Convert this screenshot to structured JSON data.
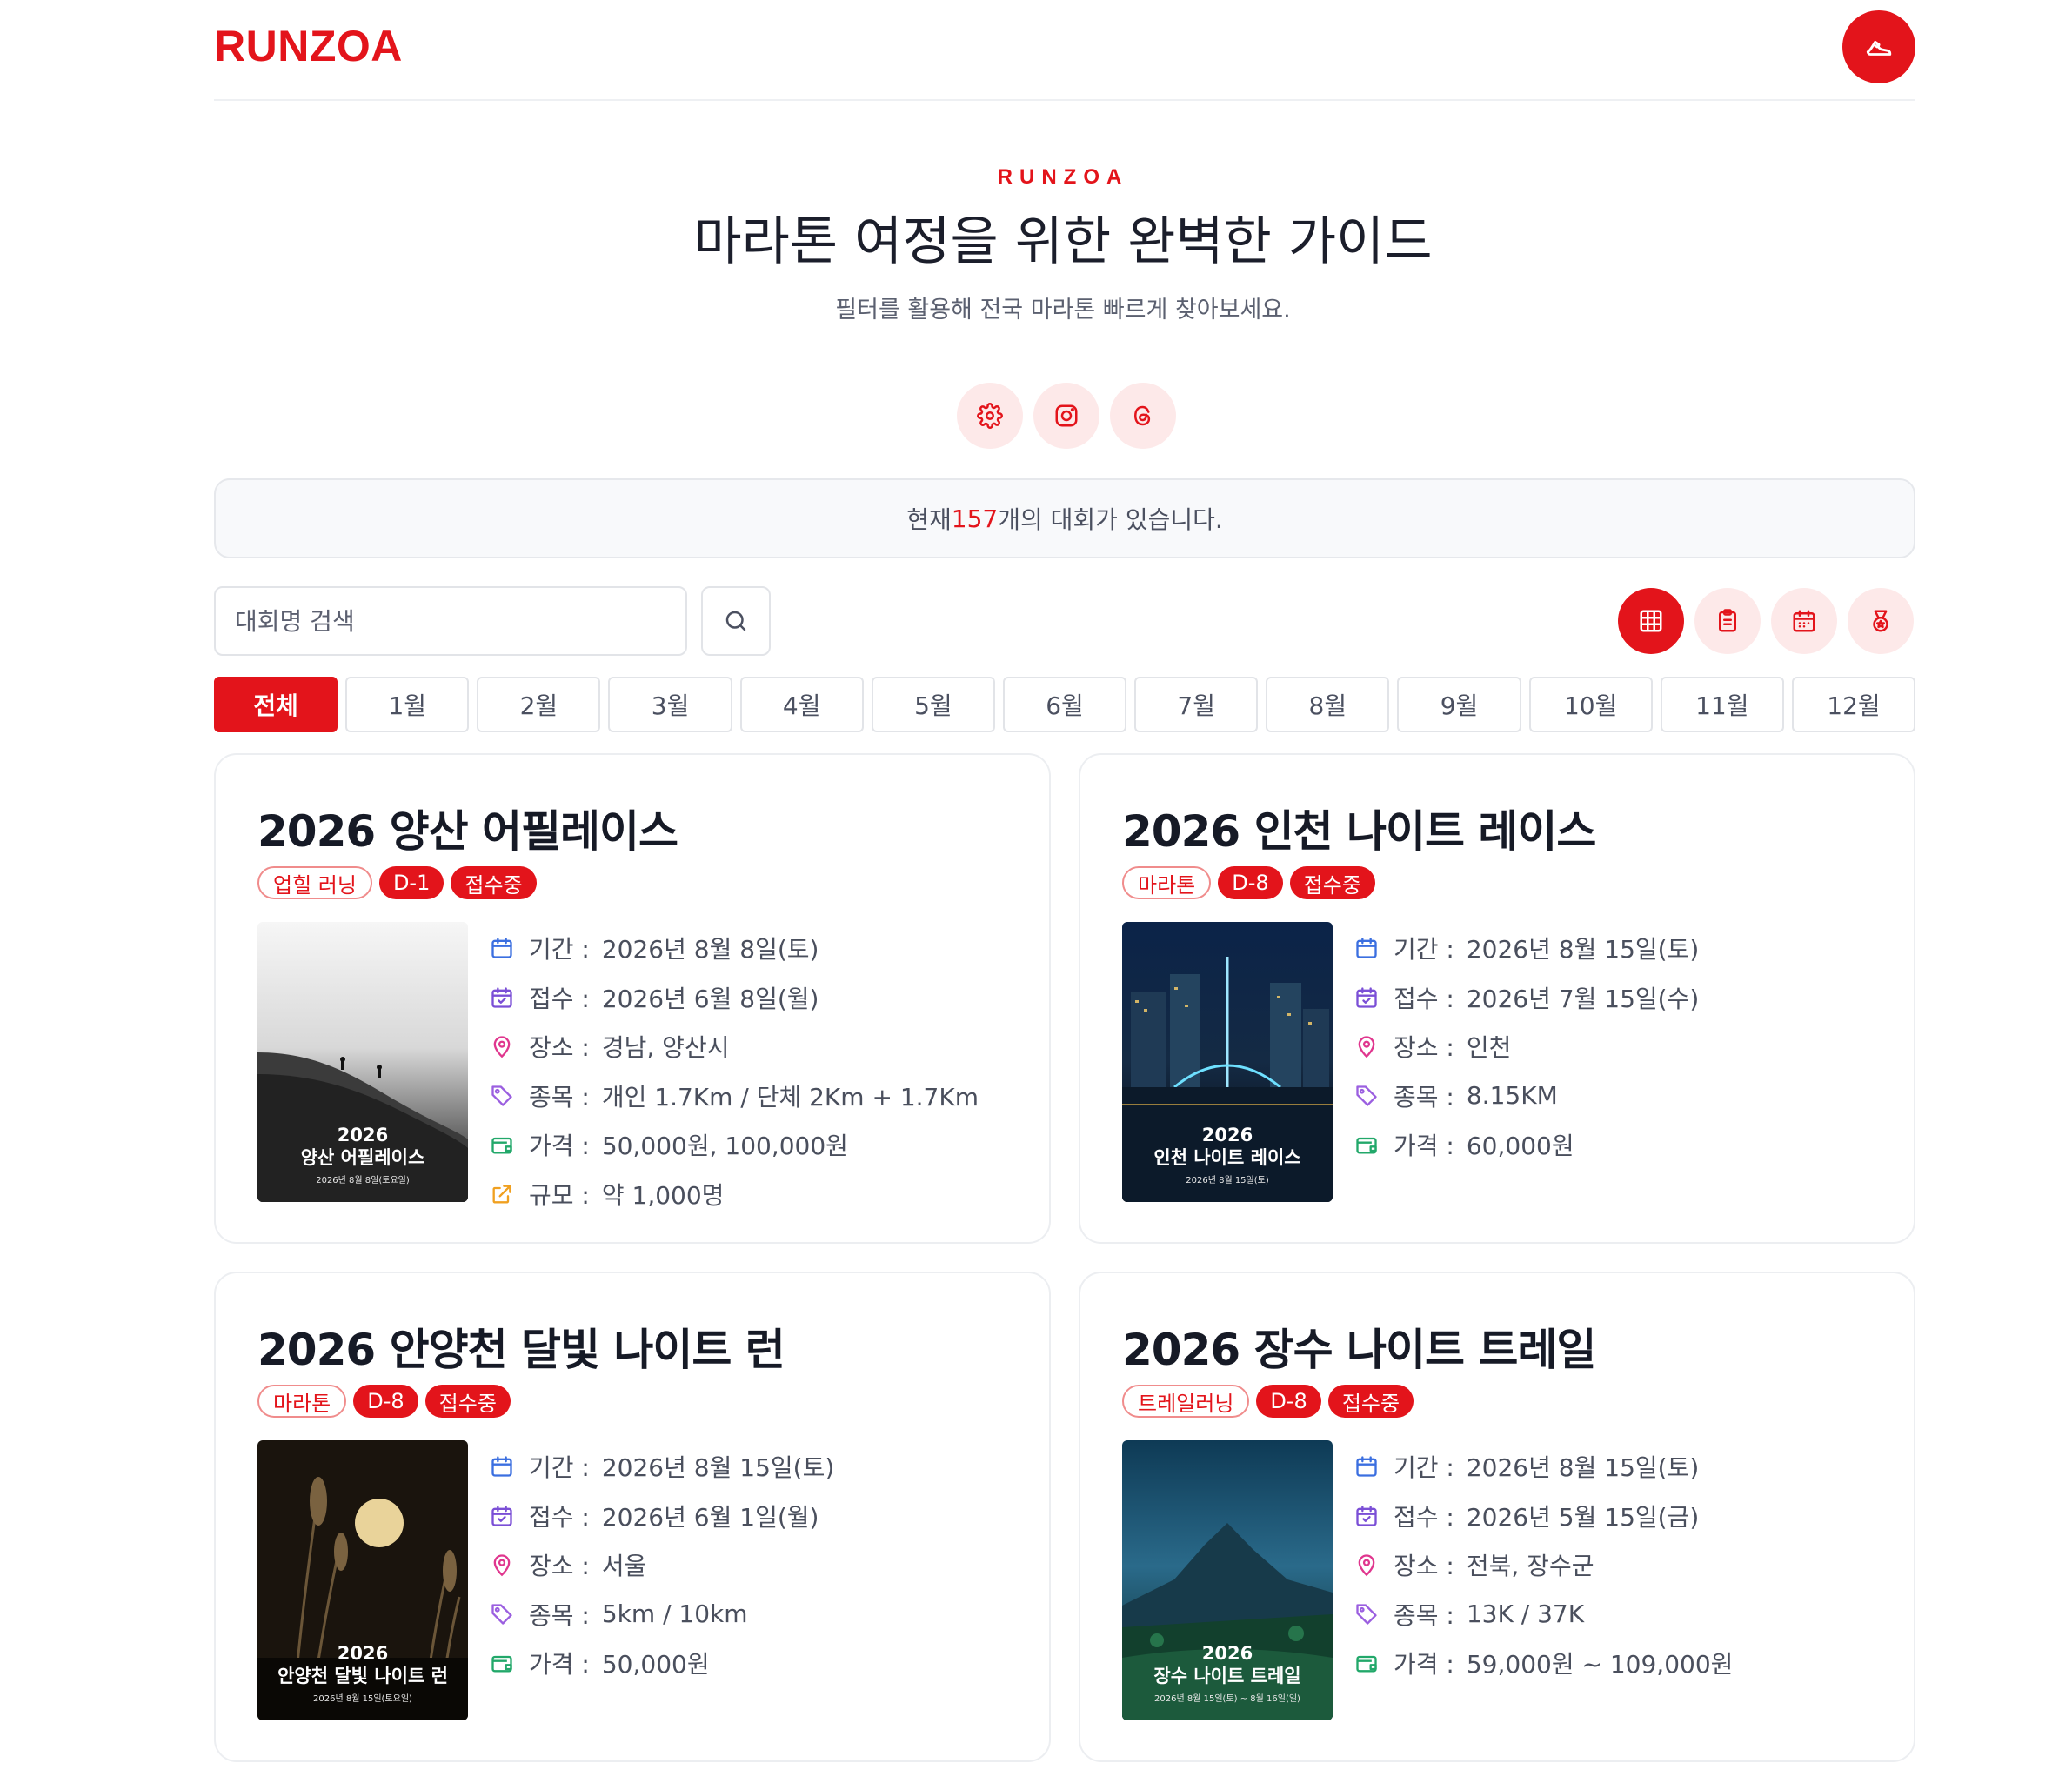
{
  "header": {
    "logo": "RUNZOA",
    "action_icon": "running-shoe-icon"
  },
  "hero": {
    "eyebrow": "RUNZOA",
    "title": "마라톤 여정을 위한 완벽한 가이드",
    "subtitle": "필터를 활용해 전국 마라톤 빠르게 찾아보세요.",
    "social_icons": [
      "settings-icon",
      "instagram-icon",
      "threads-icon"
    ]
  },
  "count": {
    "prefix": "현재 ",
    "number": "157",
    "suffix": "개의 대회가 있습니다."
  },
  "search": {
    "placeholder": "대회명 검색",
    "value": ""
  },
  "view_buttons": [
    "grid-view-icon",
    "list-view-icon",
    "calendar-view-icon",
    "medal-icon"
  ],
  "months": [
    "전체",
    "1월",
    "2월",
    "3월",
    "4월",
    "5월",
    "6월",
    "7월",
    "8월",
    "9월",
    "10월",
    "11월",
    "12월"
  ],
  "active_month": "전체",
  "labels": {
    "period": "기간 :",
    "register": "접수 :",
    "place": "장소 :",
    "event": "종목 :",
    "price": "가격 :",
    "scale": "규모 :"
  },
  "races": [
    {
      "title": "2026 양산 어필레이스",
      "category": "업힐 러닝",
      "dday": "D-1",
      "status": "접수중",
      "period": "2026년 8월 8일(토)",
      "register": "2026년 6월 8일(월)",
      "place": "경남, 양산시",
      "event": "개인 1.7Km / 단체 2Km + 1.7Km",
      "price": "50,000원, 100,000원",
      "scale": "약 1,000명",
      "poster": {
        "year": "2026",
        "name": "양산 어필레이스",
        "date": "2026년 8월 8일(토요일)"
      }
    },
    {
      "title": "2026 인천 나이트 레이스",
      "category": "마라톤",
      "dday": "D-8",
      "status": "접수중",
      "period": "2026년 8월 15일(토)",
      "register": "2026년 7월 15일(수)",
      "place": "인천",
      "event": "8.15KM",
      "price": "60,000원",
      "poster": {
        "year": "2026",
        "name": "인천 나이트 레이스",
        "date": "2026년 8월 15일(토)"
      }
    },
    {
      "title": "2026 안양천 달빛 나이트 런",
      "category": "마라톤",
      "dday": "D-8",
      "status": "접수중",
      "period": "2026년 8월 15일(토)",
      "register": "2026년 6월 1일(월)",
      "place": "서울",
      "event": "5km / 10km",
      "price": "50,000원",
      "poster": {
        "year": "2026",
        "name": "안양천 달빛 나이트 런",
        "date": "2026년 8월 15일(토요일)"
      }
    },
    {
      "title": "2026 장수 나이트 트레일",
      "category": "트레일러닝",
      "dday": "D-8",
      "status": "접수중",
      "period": "2026년 8월 15일(토)",
      "register": "2026년 5월 15일(금)",
      "place": "전북, 장수군",
      "event": "13K / 37K",
      "price": "59,000원 ~ 109,000원",
      "poster": {
        "year": "2026",
        "name": "장수 나이트 트레일",
        "date": "2026년 8월 15일(토) ~ 8월 16일(일)"
      }
    }
  ],
  "colors": {
    "brand": "#e3141b",
    "brand_soft": "#fde9e9",
    "icon_period": "#3b6fe0",
    "icon_register": "#7b4fd6",
    "icon_place": "#e0368e",
    "icon_event": "#9b5fe0",
    "icon_price": "#22a86a",
    "icon_scale": "#f0a020"
  }
}
